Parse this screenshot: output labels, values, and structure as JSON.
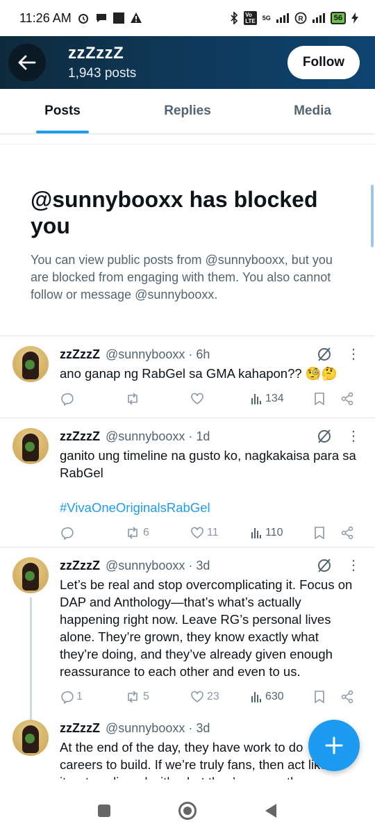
{
  "status": {
    "time": "11:26 AM",
    "network": "5G",
    "battery": "56"
  },
  "header": {
    "name": "zzZzzZ",
    "posts": "1,943 posts",
    "follow_label": "Follow"
  },
  "tabs": [
    {
      "label": "Posts"
    },
    {
      "label": "Replies"
    },
    {
      "label": "Media"
    }
  ],
  "blocked": {
    "title": "@sunnybooxx has blocked you",
    "description": "You can view public posts from @sunnybooxx, but you are blocked from engaging with them. You also cannot follow or message @sunnybooxx."
  },
  "tweets": [
    {
      "name": "zzZzzZ",
      "handle": "@sunnybooxx · 6h",
      "text": "ano ganap ng RabGel sa GMA kahapon?? 🧐🤔",
      "hashtag": "",
      "replies": "",
      "reposts": "",
      "likes": "",
      "views": "134"
    },
    {
      "name": "zzZzzZ",
      "handle": "@sunnybooxx · 1d",
      "text": "ganito ung timeline na gusto ko, nagkakaisa para sa RabGel",
      "hashtag": "#VivaOneOriginalsRabGel",
      "replies": "",
      "reposts": "6",
      "likes": "11",
      "views": "110"
    },
    {
      "name": "zzZzzZ",
      "handle": "@sunnybooxx · 3d",
      "text": "Let’s be real and stop overcomplicating it. Focus on DAP and Anthology—that’s what’s actually happening right now. Leave RG’s personal lives alone. They’re grown, they know exactly what they’re doing, and they’ve already given enough reassurance to each other and even to us.",
      "hashtag": "",
      "replies": "1",
      "reposts": "5",
      "likes": "23",
      "views": "630"
    },
    {
      "name": "zzZzzZ",
      "handle": "@sunnybooxx · 3d",
      "text": "At the end of the day, they have work to do careers to build. If we’re truly fans, then act like it—stay aligned with what they’re currently creating",
      "hashtag": "",
      "replies": "",
      "reposts": "",
      "likes": "",
      "views": ""
    }
  ],
  "icons": {
    "back": "arrow-left-icon",
    "grok": "grok-icon",
    "more": "more-vertical-icon",
    "compose": "plus-icon"
  },
  "colors": {
    "accent": "#1d9bf0",
    "header": "#0f3a5c"
  }
}
